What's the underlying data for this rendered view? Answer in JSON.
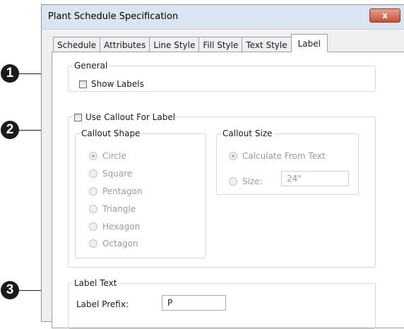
{
  "dialog": {
    "title": "Plant Schedule Specification",
    "close_glyph": "x",
    "tabs": [
      "Schedule",
      "Attributes",
      "Line Style",
      "Fill Style",
      "Text Style",
      "Label"
    ],
    "active_tab": "Label"
  },
  "callouts": [
    "1",
    "2",
    "3"
  ],
  "general": {
    "legend": "General",
    "show_labels": {
      "label": "Show Labels",
      "checked": false
    }
  },
  "callout_section": {
    "use_callout": {
      "label": "Use Callout For Label",
      "checked": false
    },
    "shape": {
      "legend": "Callout Shape",
      "options": [
        "Circle",
        "Square",
        "Pentagon",
        "Triangle",
        "Hexagon",
        "Octagon"
      ],
      "selected": "Circle"
    },
    "size": {
      "legend": "Callout Size",
      "calc_label": "Calculate From Text",
      "size_label": "Size:",
      "size_value": "24\"",
      "selected": "Calculate From Text"
    }
  },
  "label_text": {
    "legend": "Label Text",
    "prefix_label": "Label Prefix:",
    "prefix_value": "P"
  },
  "colors": {
    "accent_close": "#c7503a",
    "title_bar": "#dbe5f1",
    "disabled_text": "#9a9a9a"
  }
}
